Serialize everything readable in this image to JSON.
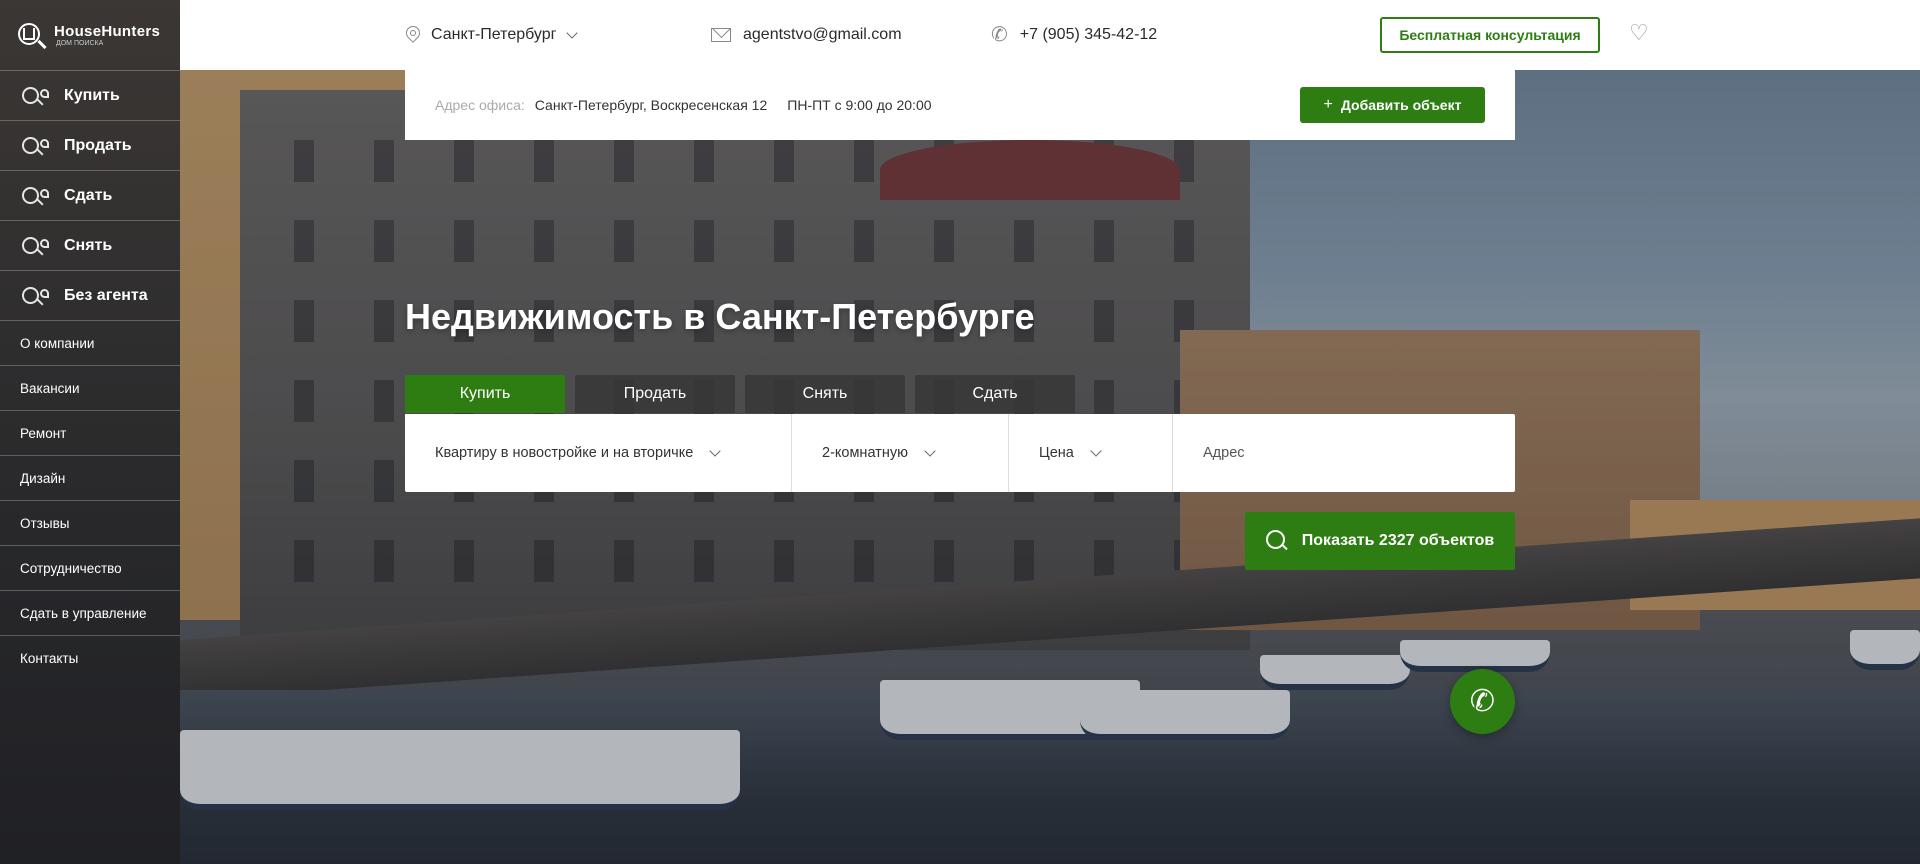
{
  "brand": {
    "name": "HouseHunters",
    "tagline": "ДОМ ПОИСКА"
  },
  "sidebar": {
    "main_items": [
      {
        "label": "Купить",
        "icon": "search-house-icon"
      },
      {
        "label": "Продать",
        "icon": "search-house-icon"
      },
      {
        "label": "Сдать",
        "icon": "search-house-icon"
      },
      {
        "label": "Снять",
        "icon": "search-house-icon"
      },
      {
        "label": "Без агента",
        "icon": "search-house-icon"
      }
    ],
    "links": [
      "О компании",
      "Вакансии",
      "Ремонт",
      "Дизайн",
      "Отзывы",
      "Сотрудничество",
      "Сдать в управление",
      "Контакты"
    ]
  },
  "header": {
    "city": "Санкт-Петербург",
    "email": "agentstvo@gmail.com",
    "phone": "+7 (905) 345-42-12",
    "consult_label": "Бесплатная консультация",
    "fav_icon": "heart-icon"
  },
  "office": {
    "label": "Адрес офиса:",
    "address": "Санкт-Петербург, Воскресенская 12",
    "hours": "ПН-ПТ с 9:00 до 20:00",
    "add_label": "Добавить объект"
  },
  "hero": {
    "title": "Недвижимость в Санкт-Петербурге",
    "tabs": [
      "Купить",
      "Продать",
      "Снять",
      "Сдать"
    ],
    "active_tab": 0
  },
  "search": {
    "type": "Квартиру в новостройке и на вторичке",
    "rooms": "2-комнатную",
    "price": "Цена",
    "address_placeholder": "Адрес",
    "show_label": "Показать 2327 объектов"
  },
  "colors": {
    "accent": "#2e7d13",
    "sidebar": "#2f2e30"
  }
}
